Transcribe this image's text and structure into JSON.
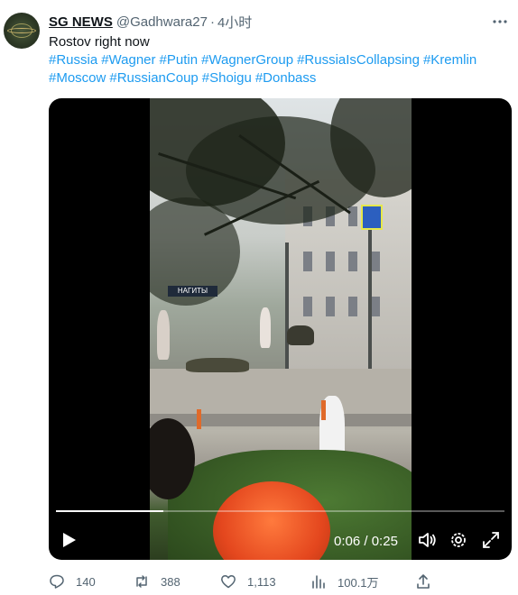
{
  "author": {
    "name": "SG NEWS",
    "handle": "@Gadhwara27",
    "separator": "·",
    "time": "4小时"
  },
  "tweet": {
    "text": "Rostov right now",
    "hashtags_line1": [
      "#Russia",
      "#Wagner",
      "#Putin",
      "#WagnerGroup",
      "#RussiaIsCollapsing",
      "#Kremlin"
    ],
    "hashtags_line2": [
      "#Moscow",
      "#RussianCoup",
      "#Shoigu",
      "#Donbass"
    ]
  },
  "video": {
    "current_time": "0:06",
    "duration": "0:25",
    "progress_fraction": 0.24,
    "frame_sign_text": "НАГИТЫ"
  },
  "actions": {
    "replies": "140",
    "retweets": "388",
    "likes": "1,113",
    "views": "100.1万"
  },
  "colors": {
    "link": "#1d9bf0",
    "muted": "#536471",
    "text": "#0f1419"
  },
  "icons": [
    "more-icon",
    "play-icon",
    "volume-icon",
    "settings-gear-icon",
    "fullscreen-icon",
    "reply-icon",
    "retweet-icon",
    "like-heart-icon",
    "views-bar-icon",
    "share-icon"
  ]
}
